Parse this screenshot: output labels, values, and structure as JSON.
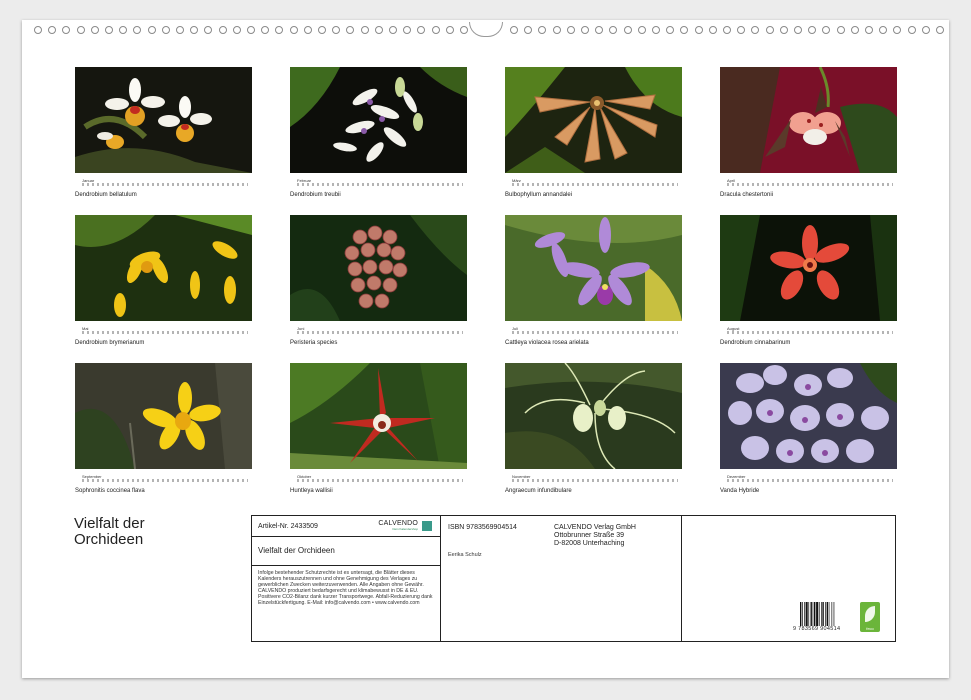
{
  "calendar": {
    "title_lines": [
      "Vielfalt der",
      "Orchideen"
    ],
    "months": [
      {
        "month": "Januar",
        "year": "2027",
        "caption": "Dendrobium bellatulum"
      },
      {
        "month": "Februar",
        "year": "2027",
        "caption": "Dendrobium treubii"
      },
      {
        "month": "März",
        "year": "2027",
        "caption": "Bulbophyllum annandalei"
      },
      {
        "month": "April",
        "year": "2027",
        "caption": "Dracula chestertonii"
      },
      {
        "month": "Mai",
        "year": "2027",
        "caption": "Dendrobium brymerianum"
      },
      {
        "month": "Juni",
        "year": "2027",
        "caption": "Peristeria species"
      },
      {
        "month": "Juli",
        "year": "2027",
        "caption": "Cattleya violacea rosea arielata"
      },
      {
        "month": "August",
        "year": "2027",
        "caption": "Dendrobium cinnabarinum"
      },
      {
        "month": "September",
        "year": "2027",
        "caption": "Sophronitis coccinea flava"
      },
      {
        "month": "Oktober",
        "year": "2027",
        "caption": "Huntleya wallisii"
      },
      {
        "month": "November",
        "year": "2027",
        "caption": "Angraecum infundibulare"
      },
      {
        "month": "Dezember",
        "year": "2027",
        "caption": "Vanda Hybride"
      }
    ]
  },
  "info": {
    "article_number": "Artikel-Nr. 2433509",
    "brand": "CALVENDO",
    "brand_tagline": "Dein Kalendershop",
    "calendar_title": "Vielfalt der Orchideen",
    "legal_text": "Infolge bestehender Schutzrechte ist es untersagt, die Blätter dieses Kalenders herauszutrennen und ohne Genehmigung des Verlages zu gewerblichen Zwecken weiterzuverwenden. Alle Angaben ohne Gewähr. CALVENDO produziert bedarfsgerecht und klimabewusst in DE & EU. Positivere CO2-Bilanz dank kurzer Transportwege. Abfall-Reduzierung dank Einzelstückfertigung. E-Mail: info@calvendo.com • www.calvendo.com",
    "isbn": "ISBN 9783569904514",
    "author": "Eerika Schulz",
    "publisher_lines": [
      "CALVENDO Verlag GmbH",
      "Ottobrunner Straße 39",
      "D-82008 Unterhaching"
    ],
    "barcode_number": "9 783569 904514",
    "eco_label": "feco"
  },
  "colors": {
    "sheet": "#ffffff",
    "background": "#ececec",
    "border": "#222222",
    "eco_green": "#6bb53a"
  }
}
